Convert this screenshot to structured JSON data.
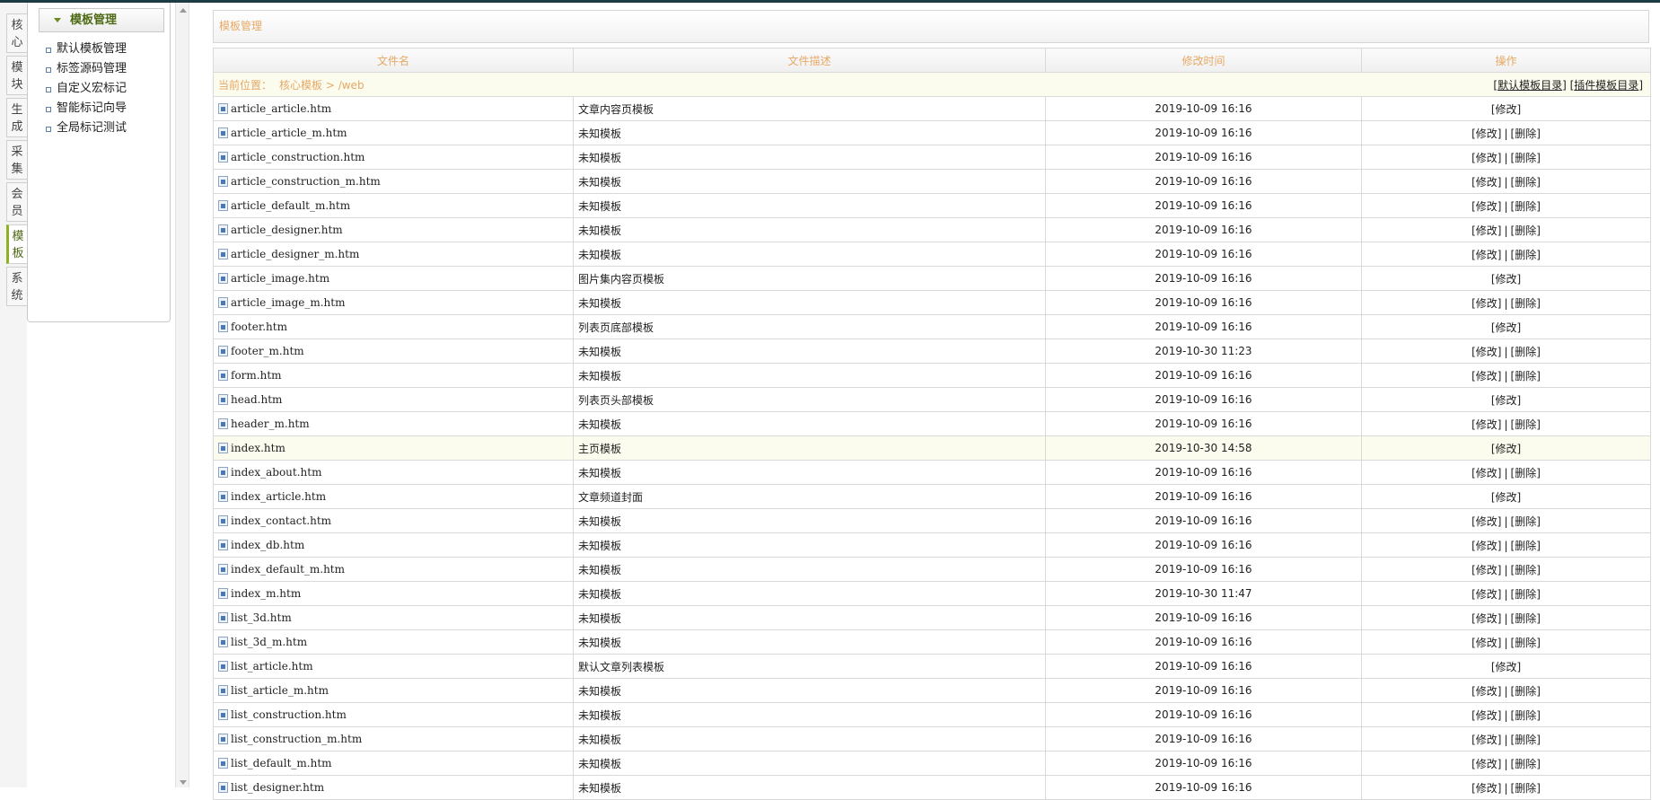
{
  "tabs": [
    {
      "label": "核\n心",
      "name": "tab-core"
    },
    {
      "label": "模\n块",
      "name": "tab-modules"
    },
    {
      "label": "生\n成",
      "name": "tab-generate"
    },
    {
      "label": "采\n集",
      "name": "tab-collect"
    },
    {
      "label": "会\n员",
      "name": "tab-members"
    },
    {
      "label": "模\n板",
      "name": "tab-templates"
    },
    {
      "label": "系\n统",
      "name": "tab-system"
    }
  ],
  "menu": {
    "title": "模板管理",
    "items": [
      "默认模板管理",
      "标签源码管理",
      "自定义宏标记",
      "智能标记向导",
      "全局标记测试"
    ]
  },
  "page_title": "模板管理",
  "table": {
    "headers": [
      "文件名",
      "文件描述",
      "修改时间",
      "操作"
    ],
    "location_label": "当前位置：",
    "location_path": "核心模板 > /web",
    "link_default_dir": "默认模板目录",
    "link_plugin_dir": "插件模板目录",
    "op_edit": "[修改]",
    "op_delete": "[删除]",
    "op_sep": "|",
    "rows": [
      {
        "name": "article_article.htm",
        "desc": "文章内容页模板",
        "time": "2019-10-09 16:16",
        "delete": false
      },
      {
        "name": "article_article_m.htm",
        "desc": "未知模板",
        "time": "2019-10-09 16:16",
        "delete": true
      },
      {
        "name": "article_construction.htm",
        "desc": "未知模板",
        "time": "2019-10-09 16:16",
        "delete": true
      },
      {
        "name": "article_construction_m.htm",
        "desc": "未知模板",
        "time": "2019-10-09 16:16",
        "delete": true
      },
      {
        "name": "article_default_m.htm",
        "desc": "未知模板",
        "time": "2019-10-09 16:16",
        "delete": true
      },
      {
        "name": "article_designer.htm",
        "desc": "未知模板",
        "time": "2019-10-09 16:16",
        "delete": true
      },
      {
        "name": "article_designer_m.htm",
        "desc": "未知模板",
        "time": "2019-10-09 16:16",
        "delete": true
      },
      {
        "name": "article_image.htm",
        "desc": "图片集内容页模板",
        "time": "2019-10-09 16:16",
        "delete": false
      },
      {
        "name": "article_image_m.htm",
        "desc": "未知模板",
        "time": "2019-10-09 16:16",
        "delete": true
      },
      {
        "name": "footer.htm",
        "desc": "列表页底部模板",
        "time": "2019-10-09 16:16",
        "delete": false
      },
      {
        "name": "footer_m.htm",
        "desc": "未知模板",
        "time": "2019-10-30 11:23",
        "delete": true
      },
      {
        "name": "form.htm",
        "desc": "未知模板",
        "time": "2019-10-09 16:16",
        "delete": true
      },
      {
        "name": "head.htm",
        "desc": "列表页头部模板",
        "time": "2019-10-09 16:16",
        "delete": false
      },
      {
        "name": "header_m.htm",
        "desc": "未知模板",
        "time": "2019-10-09 16:16",
        "delete": true
      },
      {
        "name": "index.htm",
        "desc": "主页模板",
        "time": "2019-10-30 14:58",
        "delete": false,
        "highlight": true
      },
      {
        "name": "index_about.htm",
        "desc": "未知模板",
        "time": "2019-10-09 16:16",
        "delete": true
      },
      {
        "name": "index_article.htm",
        "desc": "文章频道封面",
        "time": "2019-10-09 16:16",
        "delete": false
      },
      {
        "name": "index_contact.htm",
        "desc": "未知模板",
        "time": "2019-10-09 16:16",
        "delete": true
      },
      {
        "name": "index_db.htm",
        "desc": "未知模板",
        "time": "2019-10-09 16:16",
        "delete": true
      },
      {
        "name": "index_default_m.htm",
        "desc": "未知模板",
        "time": "2019-10-09 16:16",
        "delete": true
      },
      {
        "name": "index_m.htm",
        "desc": "未知模板",
        "time": "2019-10-30 11:47",
        "delete": true
      },
      {
        "name": "list_3d.htm",
        "desc": "未知模板",
        "time": "2019-10-09 16:16",
        "delete": true
      },
      {
        "name": "list_3d_m.htm",
        "desc": "未知模板",
        "time": "2019-10-09 16:16",
        "delete": true
      },
      {
        "name": "list_article.htm",
        "desc": "默认文章列表模板",
        "time": "2019-10-09 16:16",
        "delete": false
      },
      {
        "name": "list_article_m.htm",
        "desc": "未知模板",
        "time": "2019-10-09 16:16",
        "delete": true
      },
      {
        "name": "list_construction.htm",
        "desc": "未知模板",
        "time": "2019-10-09 16:16",
        "delete": true
      },
      {
        "name": "list_construction_m.htm",
        "desc": "未知模板",
        "time": "2019-10-09 16:16",
        "delete": true
      },
      {
        "name": "list_default_m.htm",
        "desc": "未知模板",
        "time": "2019-10-09 16:16",
        "delete": true
      },
      {
        "name": "list_designer.htm",
        "desc": "未知模板",
        "time": "2019-10-09 16:16",
        "delete": true
      }
    ]
  },
  "colors": {
    "accent_green": "#8fb021",
    "header_text": "#e6a966",
    "path_row_bg": "#fbfbee",
    "topbar": "#1c3b44"
  }
}
